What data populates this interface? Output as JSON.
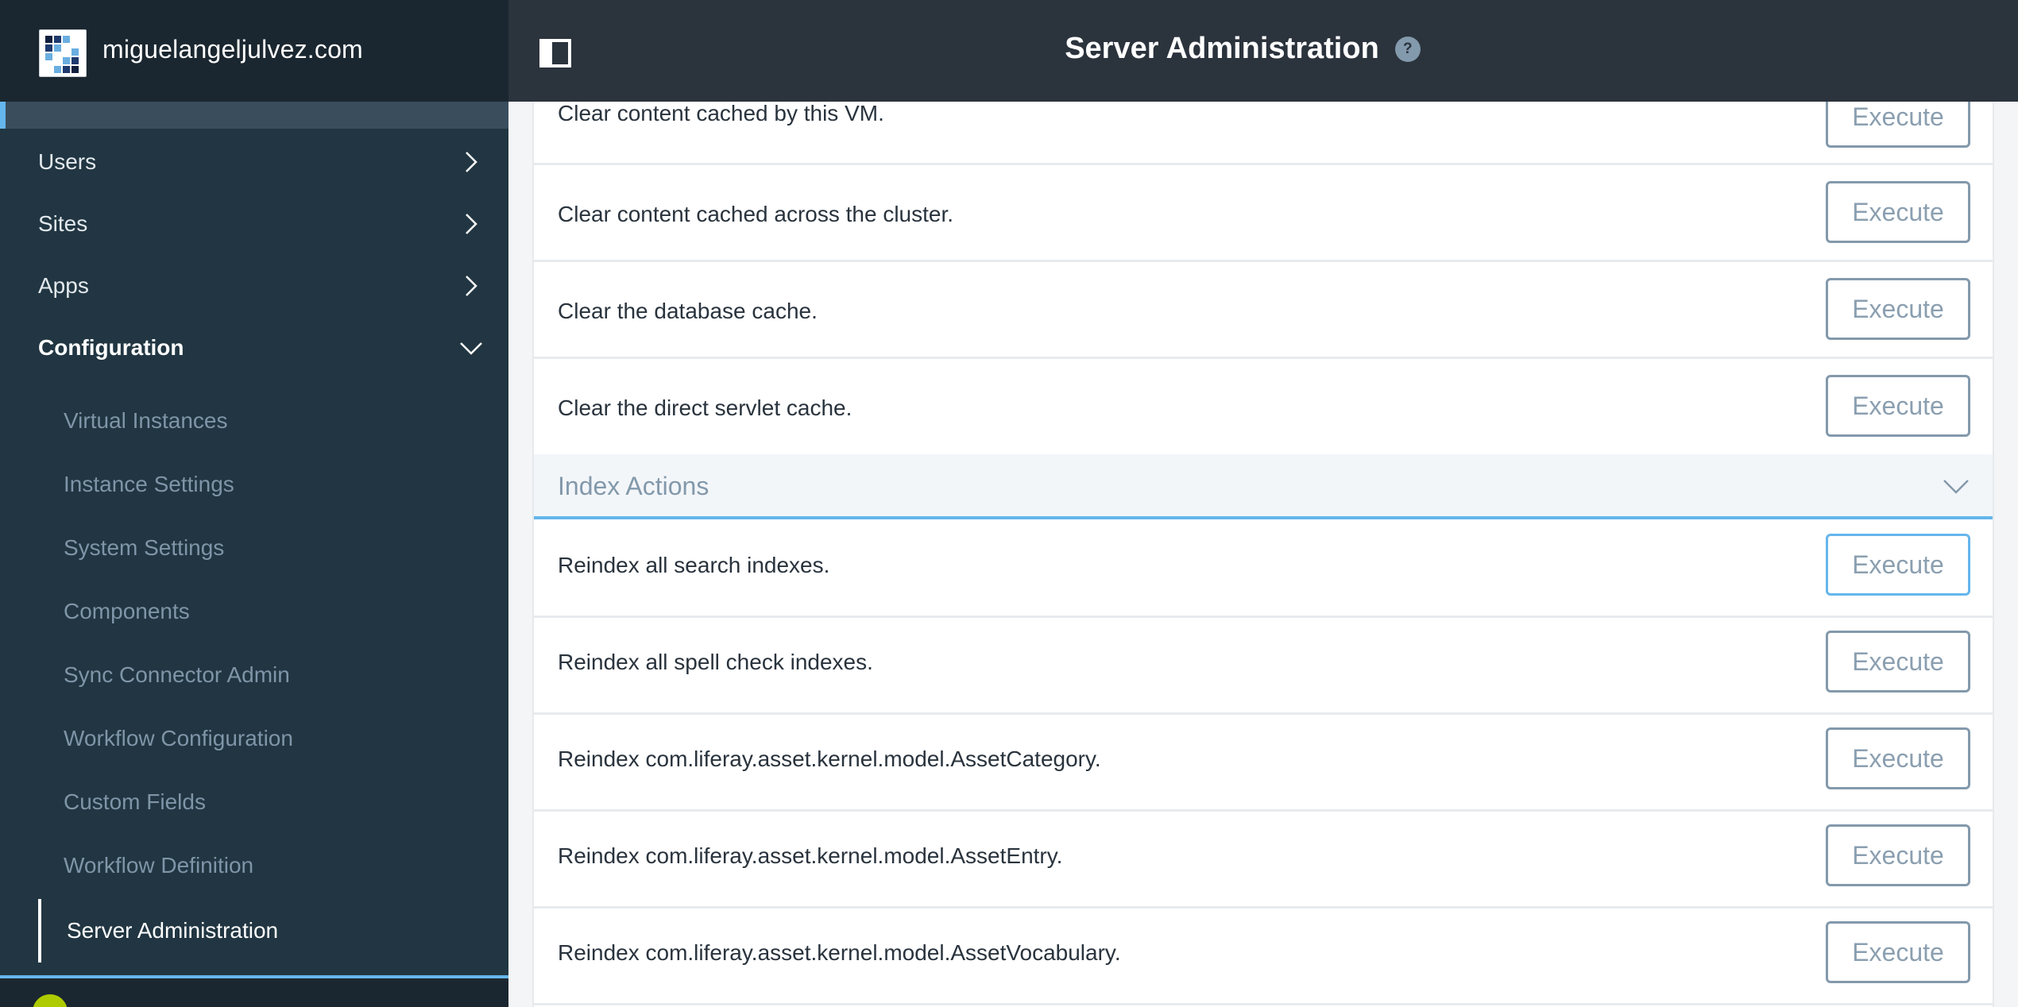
{
  "brand": {
    "name": "miguelangeljulvez.com",
    "logo_icon": "site-logo-icon"
  },
  "header": {
    "title": "Server Administration",
    "help_icon": "?",
    "toggle_icon": "sidebar-toggle-icon"
  },
  "sidebar": {
    "sections": [
      {
        "label": "Users",
        "state": "collapsed"
      },
      {
        "label": "Sites",
        "state": "collapsed"
      },
      {
        "label": "Apps",
        "state": "collapsed"
      },
      {
        "label": "Configuration",
        "state": "expanded"
      }
    ],
    "configuration_items": [
      {
        "label": "Virtual Instances"
      },
      {
        "label": "Instance Settings"
      },
      {
        "label": "System Settings"
      },
      {
        "label": "Components"
      },
      {
        "label": "Sync Connector Admin"
      },
      {
        "label": "Workflow Configuration"
      },
      {
        "label": "Custom Fields"
      },
      {
        "label": "Workflow Definition"
      },
      {
        "label": "Server Administration",
        "active": true
      }
    ]
  },
  "content": {
    "cache_actions": [
      {
        "description": "Clear content cached by this VM.",
        "button": "Execute"
      },
      {
        "description": "Clear content cached across the cluster.",
        "button": "Execute"
      },
      {
        "description": "Clear the database cache.",
        "button": "Execute"
      },
      {
        "description": "Clear the direct servlet cache.",
        "button": "Execute"
      }
    ],
    "index_section": {
      "title": "Index Actions",
      "actions": [
        {
          "description": "Reindex all search indexes.",
          "button": "Execute",
          "focused": true
        },
        {
          "description": "Reindex all spell check indexes.",
          "button": "Execute"
        },
        {
          "description": "Reindex com.liferay.asset.kernel.model.AssetCategory.",
          "button": "Execute"
        },
        {
          "description": "Reindex com.liferay.asset.kernel.model.AssetEntry.",
          "button": "Execute"
        },
        {
          "description": "Reindex com.liferay.asset.kernel.model.AssetVocabulary.",
          "button": "Execute"
        }
      ]
    }
  },
  "colors": {
    "accent": "#65b6ec",
    "sidebar_bg": "#213642",
    "header_bg": "#2b333d",
    "button_border": "#8399ab",
    "avatar": "#aecb00"
  }
}
